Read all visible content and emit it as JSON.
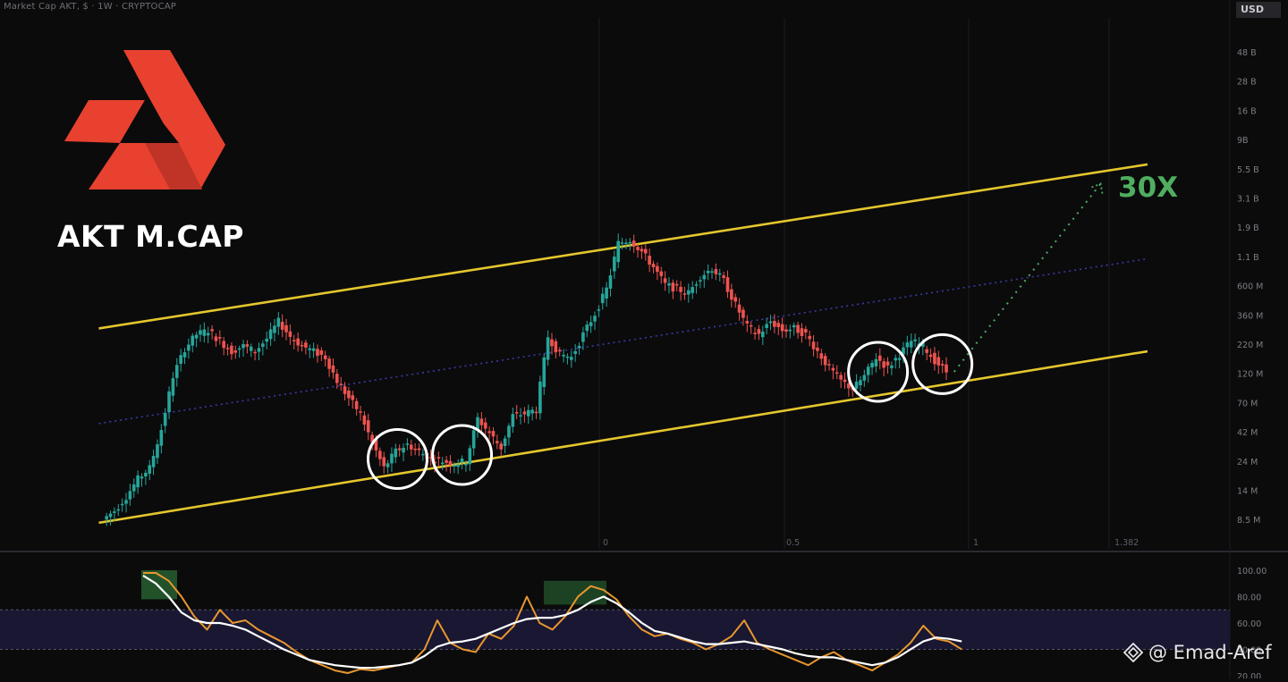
{
  "header": {
    "title": "Market Cap AKT, $ · 1W · CRYPTOCAP",
    "currency": "USD"
  },
  "brand": {
    "logo_icon": "akash-logo-icon",
    "title": "AKT M.CAP",
    "logo_colors": [
      "#e8412f",
      "#c7352a"
    ]
  },
  "annotations": {
    "target_label": "30X",
    "target_color": "#4fae5f",
    "channel_color": "#e5c62d",
    "midline_color": "#3a3aa8",
    "circle_color": "#ffffff"
  },
  "watermark": {
    "icon": "binance-square-diamond-icon",
    "text": "@ Emad-Aref"
  },
  "chart_data": [
    {
      "type": "candlestick",
      "title": "Market Cap AKT, $ · 1W · CRYPTOCAP",
      "y_scale": "log",
      "y_unit": "USD",
      "y_tick_labels": [
        "48 B",
        "28 B",
        "16 B",
        "9B",
        "5.5 B",
        "3.1 B",
        "1.9 B",
        "1.1 B",
        "600 M",
        "360 M",
        "220 M",
        "120 M",
        "70 M",
        "42 M",
        "24 M",
        "14 M",
        "8.5 M"
      ],
      "x_tick_labels": [
        "0",
        "0.5",
        "1",
        "1.382"
      ],
      "up_color": "#26a69a",
      "down_color": "#ef5350",
      "price_path_index": [
        [
          0,
          8.5
        ],
        [
          2,
          10
        ],
        [
          4,
          13
        ],
        [
          6,
          18
        ],
        [
          8,
          22
        ],
        [
          10,
          45
        ],
        [
          12,
          120
        ],
        [
          14,
          200
        ],
        [
          16,
          260
        ],
        [
          18,
          280
        ],
        [
          20,
          230
        ],
        [
          22,
          190
        ],
        [
          24,
          210
        ],
        [
          26,
          190
        ],
        [
          28,
          240
        ],
        [
          30,
          330
        ],
        [
          32,
          250
        ],
        [
          34,
          210
        ],
        [
          36,
          190
        ],
        [
          38,
          170
        ],
        [
          40,
          110
        ],
        [
          42,
          80
        ],
        [
          44,
          60
        ],
        [
          46,
          35
        ],
        [
          48,
          22
        ],
        [
          50,
          30
        ],
        [
          52,
          34
        ],
        [
          54,
          30
        ],
        [
          56,
          26
        ],
        [
          58,
          25
        ],
        [
          60,
          24
        ],
        [
          62,
          25
        ],
        [
          64,
          55
        ],
        [
          66,
          42
        ],
        [
          68,
          32
        ],
        [
          70,
          58
        ],
        [
          72,
          60
        ],
        [
          74,
          65
        ],
        [
          76,
          250
        ],
        [
          78,
          180
        ],
        [
          80,
          170
        ],
        [
          82,
          260
        ],
        [
          84,
          380
        ],
        [
          86,
          600
        ],
        [
          88,
          1400
        ],
        [
          90,
          1500
        ],
        [
          92,
          1200
        ],
        [
          94,
          900
        ],
        [
          96,
          650
        ],
        [
          98,
          600
        ],
        [
          100,
          560
        ],
        [
          102,
          760
        ],
        [
          104,
          880
        ],
        [
          106,
          700
        ],
        [
          108,
          450
        ],
        [
          110,
          300
        ],
        [
          112,
          260
        ],
        [
          114,
          330
        ],
        [
          116,
          280
        ],
        [
          118,
          290
        ],
        [
          120,
          260
        ],
        [
          122,
          190
        ],
        [
          124,
          140
        ],
        [
          126,
          110
        ],
        [
          128,
          95
        ],
        [
          130,
          120
        ],
        [
          132,
          170
        ],
        [
          134,
          140
        ],
        [
          136,
          180
        ],
        [
          138,
          230
        ],
        [
          140,
          210
        ],
        [
          142,
          160
        ],
        [
          144,
          130
        ]
      ],
      "channel": {
        "upper": {
          "from_index": -1,
          "from_value": 290,
          "to_index": 178,
          "to_value": 6000
        },
        "lower": {
          "from_index": -1,
          "from_value": 8,
          "to_index": 178,
          "to_value": 190
        },
        "mid_dotted": {
          "from_index": -1,
          "from_value": 50,
          "to_index": 178,
          "to_value": 1050
        }
      },
      "projection": {
        "type": "dotted",
        "from": [
          145,
          130
        ],
        "to": [
          170,
          4200
        ],
        "label": "30X"
      },
      "highlight_circles_at_index": [
        [
          50,
          26
        ],
        [
          61,
          28
        ],
        [
          132,
          130
        ],
        [
          143,
          150
        ]
      ]
    },
    {
      "type": "line",
      "title": "",
      "y_tick_labels": [
        "100.00",
        "80.00",
        "60.00",
        "40.00",
        "20.00"
      ],
      "ylim": [
        20,
        100
      ],
      "band": [
        40,
        70
      ],
      "series": [
        {
          "color": "#e8972f",
          "values": [
            98,
            98,
            92,
            80,
            65,
            55,
            70,
            60,
            62,
            55,
            50,
            45,
            38,
            32,
            28,
            24,
            22,
            25,
            24,
            26,
            28,
            30,
            40,
            62,
            45,
            40,
            38,
            52,
            48,
            58,
            80,
            60,
            55,
            65,
            80,
            88,
            85,
            78,
            65,
            55,
            50,
            52,
            48,
            45,
            40,
            44,
            50,
            62,
            45,
            40,
            36,
            32,
            28,
            34,
            38,
            32,
            28,
            24,
            30,
            36,
            45,
            58,
            48,
            46,
            40
          ]
        },
        {
          "color": "#ffffff",
          "values": [
            96,
            90,
            80,
            68,
            62,
            60,
            60,
            58,
            55,
            50,
            45,
            40,
            36,
            32,
            30,
            28,
            27,
            26,
            26,
            27,
            28,
            30,
            35,
            42,
            45,
            46,
            48,
            52,
            56,
            60,
            63,
            64,
            64,
            66,
            70,
            76,
            80,
            75,
            68,
            60,
            54,
            52,
            49,
            46,
            44,
            44,
            45,
            46,
            44,
            42,
            40,
            37,
            35,
            34,
            34,
            32,
            30,
            28,
            30,
            34,
            40,
            46,
            49,
            48,
            46
          ]
        }
      ]
    }
  ]
}
